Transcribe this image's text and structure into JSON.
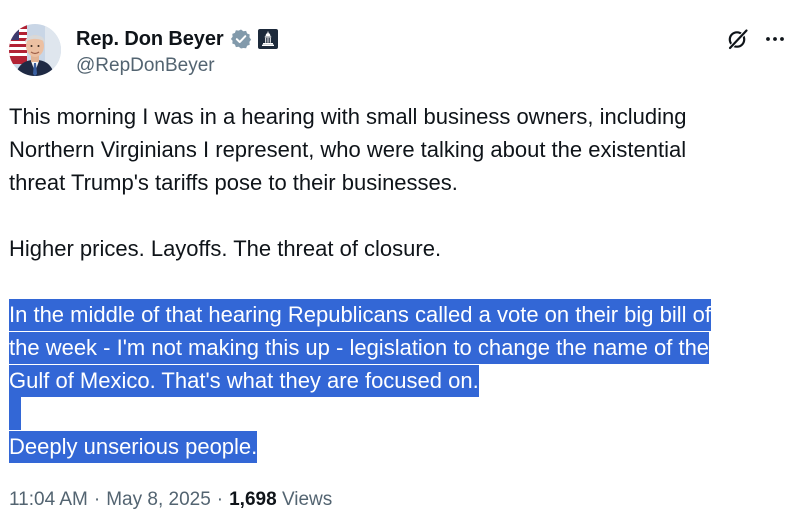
{
  "author": {
    "display_name": "Rep. Don Beyer",
    "handle": "@RepDonBeyer",
    "verified_badge_color": "#829aab",
    "gov_badge_color": "#1d2a3b"
  },
  "post": {
    "paragraphs": [
      "This morning I was in a hearing with small business owners, including",
      "Northern Virginians I represent, who were talking about the existential",
      "threat Trump's tariffs pose to their businesses."
    ],
    "paragraph2": "Higher prices. Layoffs. The threat of closure.",
    "selected_lines": [
      "In the middle of that hearing Republicans called a vote on their big bill of",
      "the week - I'm not making this up - legislation to change the name of the",
      "Gulf of Mexico. That's what they are focused on."
    ],
    "selected_last": "Deeply unserious people."
  },
  "meta": {
    "time": "11:04 AM",
    "separator": "·",
    "date": "May 8, 2025",
    "views_count": "1,698",
    "views_label": "Views"
  },
  "colors": {
    "selection_highlight": "#3367d6",
    "text_primary": "#0f1419",
    "text_secondary": "#536471"
  },
  "icons": {
    "grok": "grok-icon",
    "more": "more-options-icon"
  }
}
